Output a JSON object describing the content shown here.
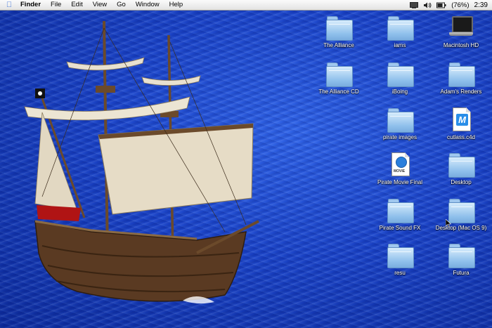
{
  "menubar": {
    "app_name": "Finder",
    "menus": [
      "File",
      "Edit",
      "View",
      "Go",
      "Window",
      "Help"
    ],
    "battery": "(76%)",
    "clock": "2:39"
  },
  "desktop_icons": [
    {
      "label": "The Alliance",
      "kind": "folder"
    },
    {
      "label": "iams",
      "kind": "folder"
    },
    {
      "label": "Macintosh HD",
      "kind": "laptop"
    },
    {
      "label": "The Alliance CD",
      "kind": "folder"
    },
    {
      "label": "iBoing",
      "kind": "folder"
    },
    {
      "label": "Adam's Renders",
      "kind": "folder"
    },
    {
      "label": "pirate images",
      "kind": "folder"
    },
    {
      "label": "cutlass.c4d",
      "kind": "c4d-document"
    },
    {
      "label": "Pirate Movie Final",
      "kind": "movie-document"
    },
    {
      "label": "Desktop",
      "kind": "folder"
    },
    {
      "label": "Pirate Sound FX",
      "kind": "folder"
    },
    {
      "label": "Desktop (Mac OS 9)",
      "kind": "folder"
    },
    {
      "label": "resu",
      "kind": "folder"
    },
    {
      "label": "Futura",
      "kind": "folder"
    }
  ],
  "doc_badges": {
    "cutlass": "M",
    "movie": "MOVIE"
  }
}
